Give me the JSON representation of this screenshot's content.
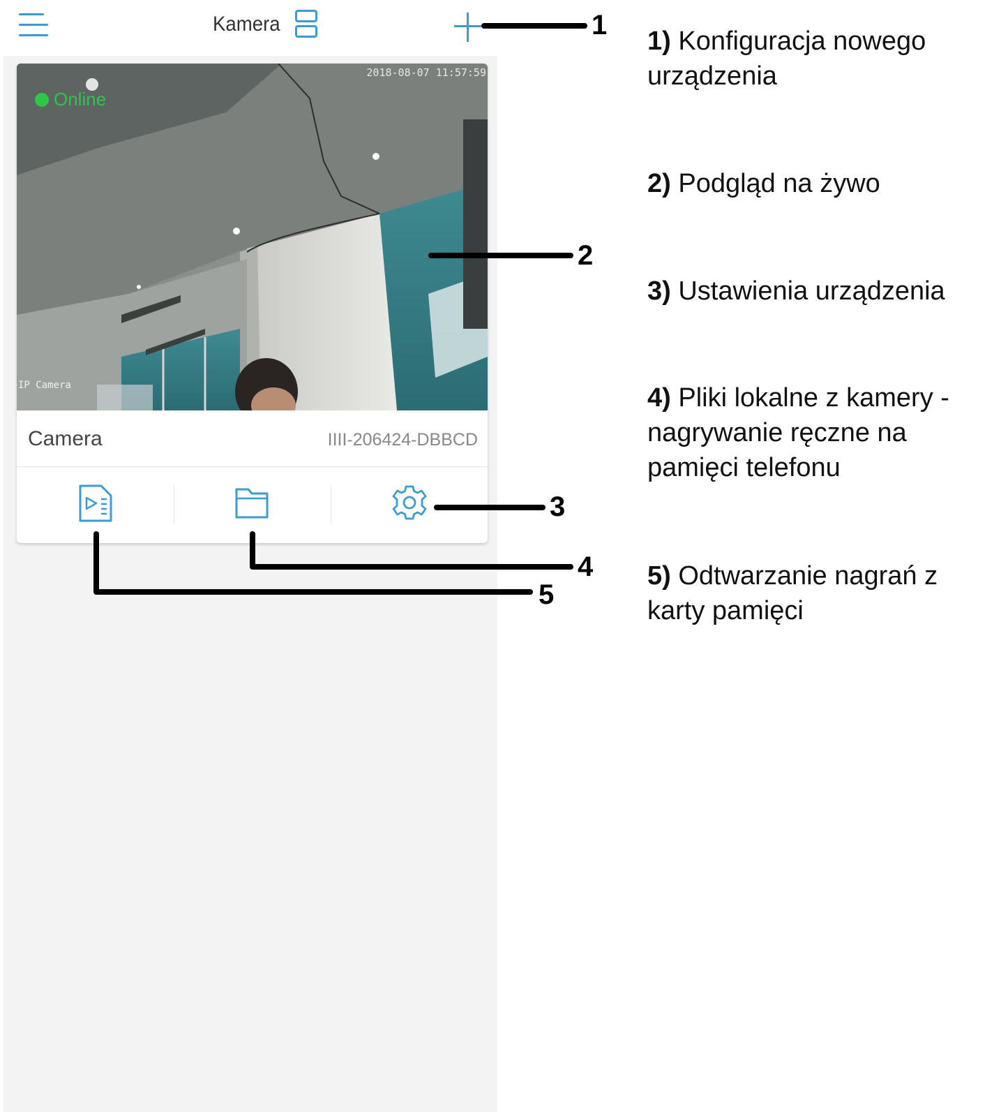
{
  "header": {
    "title": "Kamera",
    "menu_icon": "hamburger-menu-icon",
    "layout_icon": "layout-toggle-icon",
    "add_icon": "plus-icon"
  },
  "camera_card": {
    "status": "Online",
    "timestamp": "2018-08-07 11:57:59",
    "osd_name": "IP Camera",
    "device_name": "Camera",
    "device_id": "IIII-206424-DBBCD",
    "actions": [
      {
        "icon": "playback-file-icon"
      },
      {
        "icon": "folder-icon"
      },
      {
        "icon": "gear-icon"
      }
    ]
  },
  "callouts": [
    "1",
    "2",
    "3",
    "4",
    "5"
  ],
  "legend": [
    {
      "num": "1)",
      "text": "Konfiguracja nowego urządzenia"
    },
    {
      "num": "2)",
      "text": "Podgląd na żywo"
    },
    {
      "num": "3)",
      "text": "Ustawienia urządzenia"
    },
    {
      "num": "4)",
      "text": "Pliki lokalne z kamery - nagrywanie ręczne na pamięci telefonu"
    },
    {
      "num": "5)",
      "text": "Odtwarzanie nagrań z karty pamięci"
    }
  ],
  "colors": {
    "accent": "#3a9bd5",
    "online": "#2ec646",
    "app_background": "#f3f3f3"
  }
}
